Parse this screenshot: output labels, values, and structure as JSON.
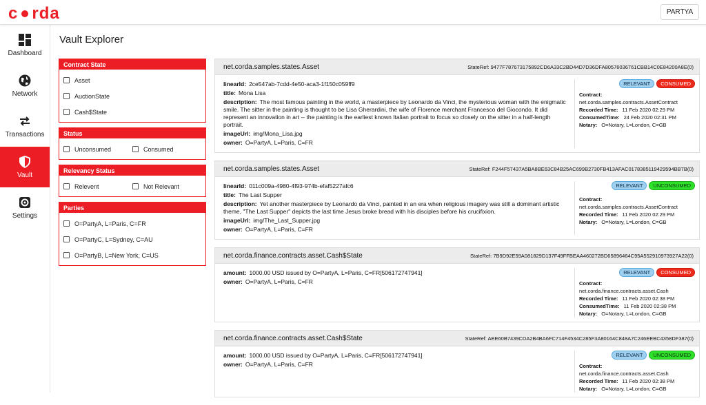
{
  "app": {
    "logo_left": "c",
    "logo_right": "rda",
    "party_button": "PARTYA"
  },
  "sidebar": {
    "items": [
      {
        "label": "Dashboard",
        "icon": "dashboard-icon"
      },
      {
        "label": "Network",
        "icon": "globe-icon"
      },
      {
        "label": "Transactions",
        "icon": "transfer-arrows-icon"
      },
      {
        "label": "Vault",
        "icon": "shield-icon",
        "active": true
      },
      {
        "label": "Settings",
        "icon": "gear-icon"
      }
    ]
  },
  "page": {
    "title": "Vault Explorer"
  },
  "filters": {
    "contract_state": {
      "title": "Contract State",
      "options": [
        "Asset",
        "AuctionState",
        "Cash$State"
      ]
    },
    "status": {
      "title": "Status",
      "options": [
        "Unconsumed",
        "Consumed"
      ]
    },
    "relevancy": {
      "title": "Relevancy Status",
      "options": [
        "Relevent",
        "Not Relevant"
      ]
    },
    "parties": {
      "title": "Parties",
      "options": [
        "O=PartyA, L=Paris, C=FR",
        "O=PartyC, L=Sydney, C=AU",
        "O=PartyB, L=New York, C=US"
      ]
    }
  },
  "labels": {
    "linear_id": "linearId:",
    "title": "title:",
    "description": "description:",
    "image_url": "imageUrl:",
    "owner": "owner:",
    "amount": "amount:",
    "contract": "Contract:",
    "recorded_time": "Recorded Time:",
    "consumed_time": "ConsumedTime:",
    "notary": "Notary:",
    "relevant": "RELEVANT",
    "consumed": "CONSUMED",
    "unconsumed": "UNCONSUMED"
  },
  "colors": {
    "brand_red": "#ec1d24",
    "relevant_blue": "#9fd0f0",
    "consumed_red": "#ef2a1b",
    "unconsumed_green": "#2ee02a"
  },
  "cards": [
    {
      "title": "net.corda.samples.states.Asset",
      "state_ref": "StateRef: 9477F787673175892CD6A33C2BD44D7D36DFA80576036761CBB14C0E84200A8E(0)",
      "linear_id": "2ce547ab-7cdd-4e50-aca3-1f150c059ff9",
      "title_value": "Mona Lisa",
      "description": "The most famous painting in the world, a masterpiece by Leonardo da Vinci, the mysterious woman with the enigmatic smile. The sitter in the painting is thought to be Lisa Gherardini, the wife of Florence merchant Francesco del Giocondo. It did represent an innovation in art -- the painting is the earliest known Italian portrait to focus so closely on the sitter in a half-length portrait.",
      "image_url": "img/Mona_Lisa.jpg",
      "owner": "O=PartyA, L=Paris, C=FR",
      "status": "consumed",
      "contract": "net.corda.samples.contracts.AssetContract",
      "recorded_time": "11 Feb 2020 02:29 PM",
      "consumed_time": "24 Feb 2020 02:31 PM",
      "notary": "O=Notary, L=London, C=GB"
    },
    {
      "title": "net.corda.samples.states.Asset",
      "state_ref": "StateRef: F244F57437A5BA8BE63C84B25AC699B2730FB413AFAC0178385119429594BB7B(0)",
      "linear_id": "011c009a-4980-4f93-974b-efaf5227afc6",
      "title_value": "The Last Supper",
      "description": "Yet another masterpiece by Leonardo da Vinci, painted in an era when religious imagery was still a dominant artistic theme, \"The Last Supper\" depicts the last time Jesus broke bread with his disciples before his crucifixion.",
      "image_url": "img/The_Last_Supper.jpg",
      "owner": "O=PartyA, L=Paris, C=FR",
      "status": "unconsumed",
      "contract": "net.corda.samples.contracts.AssetContract",
      "recorded_time": "11 Feb 2020 02:29 PM",
      "notary": "O=Notary, L=London, C=GB"
    },
    {
      "title": "net.corda.finance.contracts.asset.Cash$State",
      "state_ref": "StateRef: 7B9D92E59A081829D137F49FFBEAA460272BD65896464C95A552910973927A22(0)",
      "amount": "1000.00 USD issued by O=PartyA, L=Paris, C=FR[506172747941]",
      "owner": "O=PartyA, L=Paris, C=FR",
      "status": "consumed",
      "contract": "net.corda.finance.contracts.asset.Cash",
      "recorded_time": "11 Feb 2020 02:38 PM",
      "consumed_time": "11 Feb 2020 02:38 PM",
      "notary": "O=Notary, L=London, C=GB"
    },
    {
      "title": "net.corda.finance.contracts.asset.Cash$State",
      "state_ref": "StateRef: AEE60B7439CDA2B4BA6FC714F4534C285F3A80164C848A7C246EEBC4358DF387(0)",
      "amount": "1000.00 USD issued by O=PartyA, L=Paris, C=FR[506172747941]",
      "owner": "O=PartyA, L=Paris, C=FR",
      "status": "unconsumed",
      "contract": "net.corda.finance.contracts.asset.Cash",
      "recorded_time": "11 Feb 2020 02:38 PM",
      "notary": "O=Notary, L=London, C=GB"
    }
  ]
}
